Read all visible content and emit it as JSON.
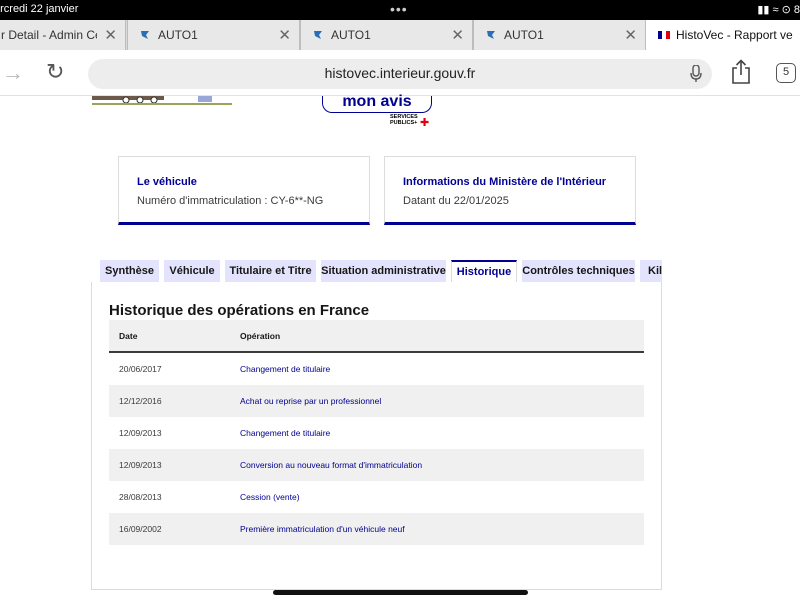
{
  "status_bar": {
    "time": "ercredi 22 janvier",
    "dots": "•••",
    "icons": "▮▮ ≈ ⊙ 8"
  },
  "browser_tabs": [
    {
      "title": "r Detail - Admin Ce",
      "close": "✕"
    },
    {
      "title": "AUTO1",
      "close": "✕"
    },
    {
      "title": "AUTO1",
      "close": "✕"
    },
    {
      "title": "AUTO1",
      "close": "✕"
    },
    {
      "title": "HistoVec - Rapport ve",
      "close": "✕"
    }
  ],
  "toolbar": {
    "forward_glyph": "→",
    "reload_glyph": "↻",
    "url": "histovec.interieur.gouv.fr",
    "tab_count": "5"
  },
  "header": {
    "mon_avis_label": "mon avis",
    "services_publics": "SERVICES PUBLICS+",
    "services_plus": "✚"
  },
  "cards": [
    {
      "title": "Le véhicule",
      "text": "Numéro d'immatriculation : CY-6**-NG"
    },
    {
      "title": "Informations du Ministère de l'Intérieur",
      "text": "Datant du 22/01/2025"
    }
  ],
  "content_tabs": [
    "Synthèse",
    "Véhicule",
    "Titulaire et Titre",
    "Situation administrative",
    "Historique",
    "Contrôles techniques",
    "Kilo"
  ],
  "history": {
    "title": "Historique des opérations en France",
    "col_date": "Date",
    "col_operation": "Opération",
    "rows": [
      {
        "date": "20/06/2017",
        "operation": "Changement de titulaire"
      },
      {
        "date": "12/12/2016",
        "operation": "Achat ou reprise par un professionnel"
      },
      {
        "date": "12/09/2013",
        "operation": "Changement de titulaire"
      },
      {
        "date": "12/09/2013",
        "operation": "Conversion au nouveau format d'immatriculation"
      },
      {
        "date": "28/08/2013",
        "operation": "Cession (vente)"
      },
      {
        "date": "16/09/2002",
        "operation": "Première immatriculation d'un véhicule neuf"
      }
    ]
  },
  "colors": {
    "accent": "#000091",
    "tab_bg": "#e3e3fd",
    "row_alt": "#f0f0f0"
  }
}
